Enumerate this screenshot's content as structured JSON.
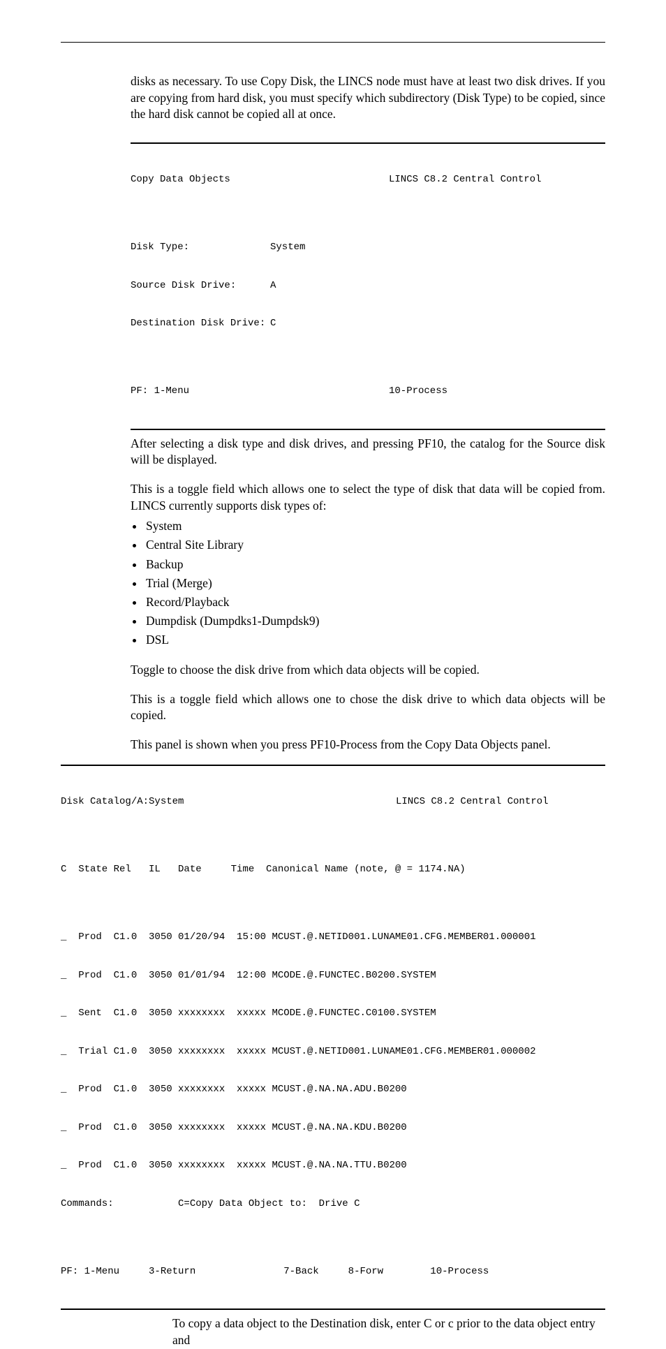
{
  "intro": "disks as necessary. To use Copy Disk, the LINCS node must have at least two disk drives. If you are copying from hard disk, you must specify which subdirectory (Disk Type) to be copied, since the hard disk cannot be copied all at once.",
  "panel1": {
    "title_left": "Copy Data Objects",
    "title_right": "LINCS C8.2 Central Control",
    "disk_type_label": "Disk Type:",
    "disk_type_value": "System",
    "src_label": "Source Disk Drive:",
    "src_value": "A",
    "dst_label": "Destination Disk Drive:",
    "dst_value": "C",
    "pf_left": "PF: 1-Menu",
    "pf_right": "10-Process"
  },
  "after_panel1": "After selecting a disk type and disk drives, and pressing PF10, the catalog for the Source disk will be displayed.",
  "toggle_intro": "This is a toggle field which allows one to select the type of disk that data will be copied from. LINCS currently supports disk types of:",
  "disk_types": [
    "System",
    "Central Site Library",
    "Backup",
    "Trial (Merge)",
    "Record/Playback",
    "Dumpdisk (Dumpdks1-Dumpdsk9)",
    "DSL"
  ],
  "src_toggle": "Toggle to choose the disk drive from which data objects will be copied.",
  "dst_toggle": "This is a toggle field which allows one to chose the disk drive to which data objects will be copied.",
  "catalog_intro": "This panel is shown when you press PF10-Process from the Copy Data Objects panel.",
  "panel2": {
    "title_left": "Disk Catalog/A:System",
    "title_right": "LINCS C8.2 Central Control",
    "header": "C  State Rel   IL   Date     Time  Canonical Name (note, @ = 1174.NA)",
    "rows": [
      "_  Prod  C1.0  3050 01/20/94  15:00 MCUST.@.NETID001.LUNAME01.CFG.MEMBER01.000001",
      "_  Prod  C1.0  3050 01/01/94  12:00 MCODE.@.FUNCTEC.B0200.SYSTEM",
      "_  Sent  C1.0  3050 xxxxxxxx  xxxxx MCODE.@.FUNCTEC.C0100.SYSTEM",
      "_  Trial C1.0  3050 xxxxxxxx  xxxxx MCUST.@.NETID001.LUNAME01.CFG.MEMBER01.000002",
      "_  Prod  C1.0  3050 xxxxxxxx  xxxxx MCUST.@.NA.NA.ADU.B0200",
      "_  Prod  C1.0  3050 xxxxxxxx  xxxxx MCUST.@.NA.NA.KDU.B0200",
      "_  Prod  C1.0  3050 xxxxxxxx  xxxxx MCUST.@.NA.NA.TTU.B0200"
    ],
    "commands": "Commands:           C=Copy Data Object to:  Drive C",
    "pf": "PF: 1-Menu     3-Return               7-Back     8-Forw        10-Process"
  },
  "closing": "To copy a data object to the Destination disk, enter C or c prior to the data object entry and"
}
